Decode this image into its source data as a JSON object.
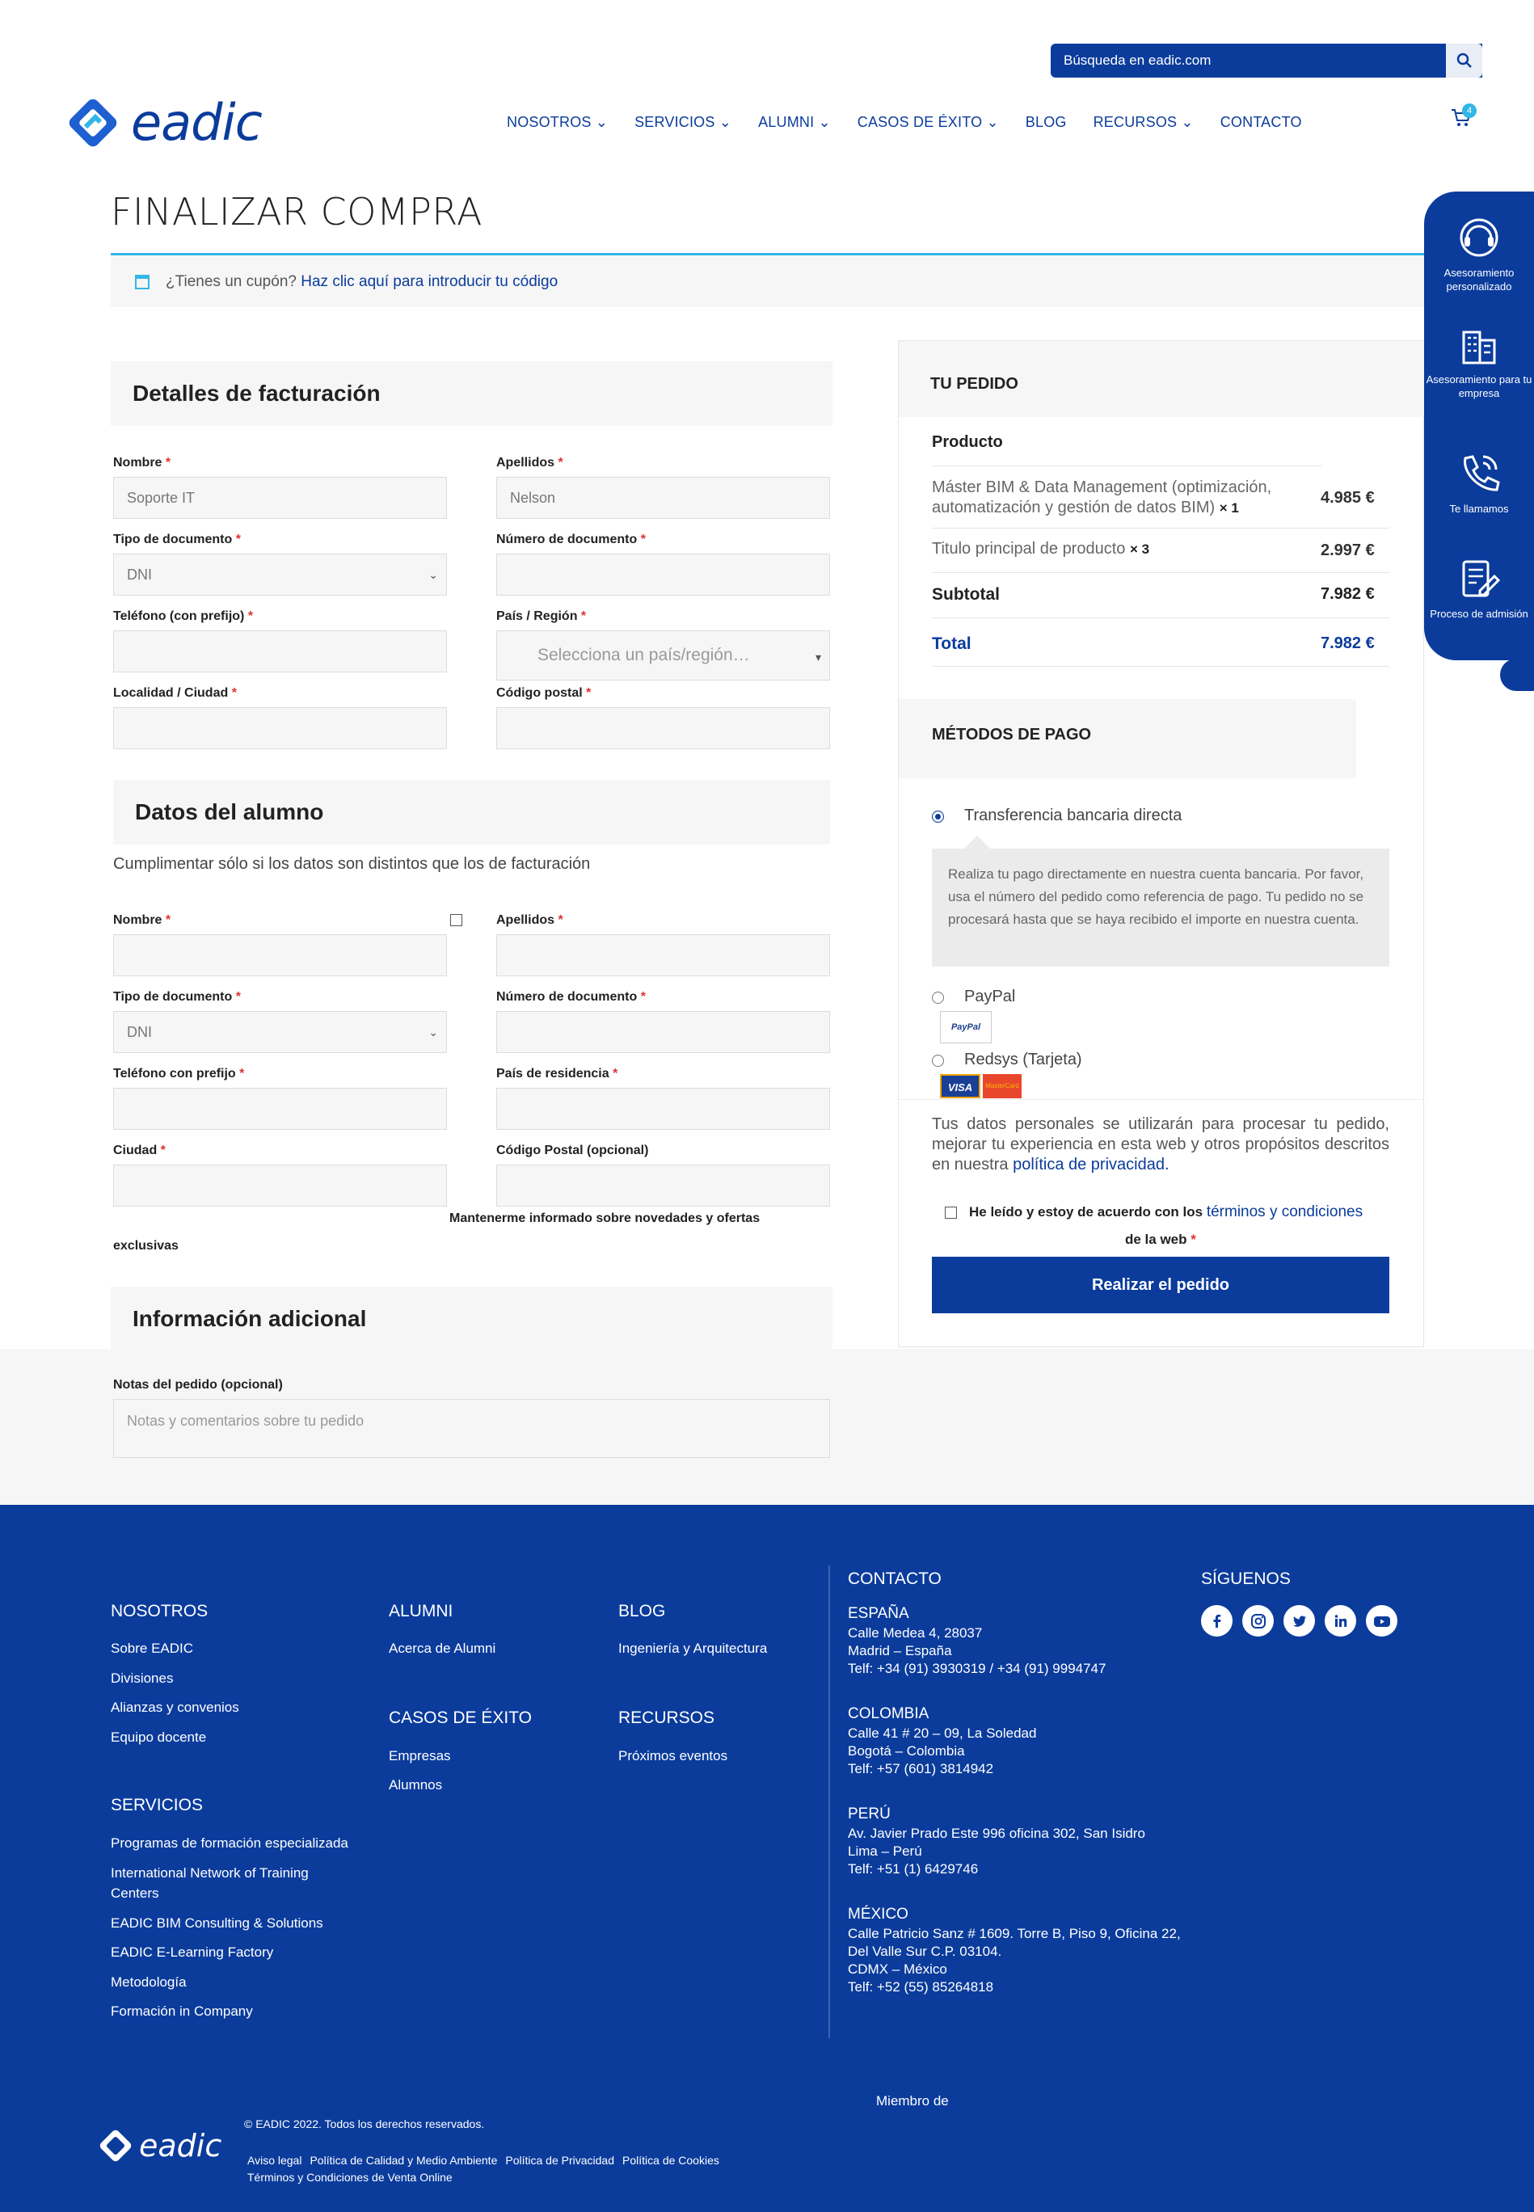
{
  "header": {
    "search_placeholder": "Búsqueda en eadic.com",
    "logo_text": "eadic",
    "nav": [
      "NOSOTROS",
      "SERVICIOS",
      "ALUMNI",
      "CASOS DE ÉXITO",
      "BLOG",
      "RECURSOS",
      "CONTACTO"
    ],
    "cart_count": "4"
  },
  "page_title": "FINALIZAR COMPRA",
  "coupon": {
    "text": "¿Tienes un cupón?",
    "link": "Haz clic aquí para introducir tu código"
  },
  "billing": {
    "title": "Detalles de facturación",
    "nombre_label": "Nombre",
    "nombre_value": "Soporte IT",
    "apellidos_label": "Apellidos",
    "apellidos_value": "Nelson",
    "tipo_doc_label": "Tipo de documento",
    "tipo_doc_value": "DNI",
    "num_doc_label": "Número de documento",
    "telefono_label": "Teléfono (con prefijo)",
    "pais_label": "País / Región",
    "pais_placeholder": "Selecciona un país/región…",
    "localidad_label": "Localidad / Ciudad",
    "cp_label": "Código postal"
  },
  "student": {
    "title": "Datos del alumno",
    "subtitle": "Cumplimentar sólo si los datos son distintos que los de facturación",
    "nombre_label": "Nombre",
    "apellidos_label": "Apellidos",
    "tipo_doc_label": "Tipo de documento",
    "tipo_doc_value": "DNI",
    "num_doc_label": "Número de documento",
    "telefono_label": "Teléfono con prefijo",
    "pais_label": "País de residencia",
    "ciudad_label": "Ciudad",
    "cp_label": "Código Postal (opcional)",
    "newsletter_a": "Mantenerme informado sobre novedades y ofertas",
    "newsletter_b": "exclusivas"
  },
  "additional": {
    "title": "Información adicional",
    "notes_label": "Notas del pedido (opcional)",
    "notes_placeholder": "Notas y comentarios sobre tu pedido"
  },
  "order": {
    "title": "TU PEDIDO",
    "col_product": "Producto",
    "item1_a": "Máster BIM & Data Management (optimización,",
    "item1_b": "automatización y gestión de datos BIM)",
    "item1_qty": "× 1",
    "item1_price": "4.985 €",
    "item2_name": "Titulo principal de producto",
    "item2_qty": "× 3",
    "item2_price": "2.997 €",
    "subtotal_label": "Subtotal",
    "subtotal_value": "7.982 €",
    "total_label": "Total",
    "total_value": "7.982 €"
  },
  "payment": {
    "title": "MÉTODOS DE PAGO",
    "opt1": "Transferencia bancaria directa",
    "opt1_desc": "Realiza tu pago directamente en nuestra cuenta bancaria. Por favor, usa el número del pedido como referencia de pago. Tu pedido no se procesará hasta que se haya recibido el importe en nuestra cuenta.",
    "opt2": "PayPal",
    "opt3": "Redsys (Tarjeta)",
    "paypal_logo": "PayPal",
    "visa_logo": "VISA",
    "mastercard_logo": "MasterCard",
    "privacy_text": "Tus datos personales se utilizarán para procesar tu pedido, mejorar tu experiencia en esta web y otros propósitos descritos en nuestra",
    "privacy_link": "política de privacidad.",
    "terms_text": "He leído y estoy de acuerdo con los",
    "terms_link": "términos y condiciones",
    "terms_text2": "de la web",
    "place_order": "Realizar el pedido"
  },
  "side_widget": [
    "Asesoramiento personalizado",
    "Asesoramiento para tu empresa",
    "Te llamamos",
    "Proceso de admisión"
  ],
  "footer": {
    "nosotros": {
      "title": "NOSOTROS",
      "links": [
        "Sobre EADIC",
        "Divisiones",
        "Alianzas y convenios",
        "Equipo docente"
      ]
    },
    "alumni": {
      "title": "ALUMNI",
      "links": [
        "Acerca de Alumni"
      ]
    },
    "blog": {
      "title": "BLOG",
      "links": [
        "Ingeniería y Arquitectura"
      ]
    },
    "casos": {
      "title": "CASOS DE ÉXITO",
      "links": [
        "Empresas",
        "Alumnos"
      ]
    },
    "recursos": {
      "title": "RECURSOS",
      "links": [
        "Próximos eventos"
      ]
    },
    "servicios": {
      "title": "SERVICIOS",
      "links": [
        "Programas de formación especializada",
        "International Network of Training",
        "Centers",
        "EADIC BIM Consulting & Solutions",
        "EADIC E-Learning Factory",
        "Metodología",
        "Formación in Company"
      ]
    },
    "contacto": {
      "title": "CONTACTO",
      "offices": [
        {
          "country": "ESPAÑA",
          "l1": "Calle Medea 4, 28037",
          "l2": "Madrid – España",
          "l3": "Telf: +34 (91) 3930319 / +34 (91) 9994747",
          "l4": ""
        },
        {
          "country": "COLOMBIA",
          "l1": "Calle 41 # 20 – 09, La Soledad",
          "l2": "Bogotá – Colombia",
          "l3": "Telf: +57 (601) 3814942",
          "l4": ""
        },
        {
          "country": "PERÚ",
          "l1": "Av. Javier Prado Este 996 oficina 302, San Isidro",
          "l2": "Lima – Perú",
          "l3": "Telf: +51 (1) 6429746",
          "l4": ""
        },
        {
          "country": "MÉXICO",
          "l1": "Calle Patricio Sanz # 1609. Torre B, Piso 9, Oficina 22,",
          "l2": "Del Valle Sur C.P. 03104.",
          "l3": "CDMX – México",
          "l4": "Telf: +52 (55) 85264818"
        }
      ]
    },
    "siguenos": "SÍGUENOS",
    "miembro": "Miembro de",
    "copyright": "© EADIC 2022. Todos los derechos reservados.",
    "legal1": [
      "Aviso legal",
      "Política de Calidad y Medio Ambiente",
      "Política de Privacidad",
      "Política de Cookies"
    ],
    "legal2": "Términos y Condiciones de Venta Online"
  }
}
